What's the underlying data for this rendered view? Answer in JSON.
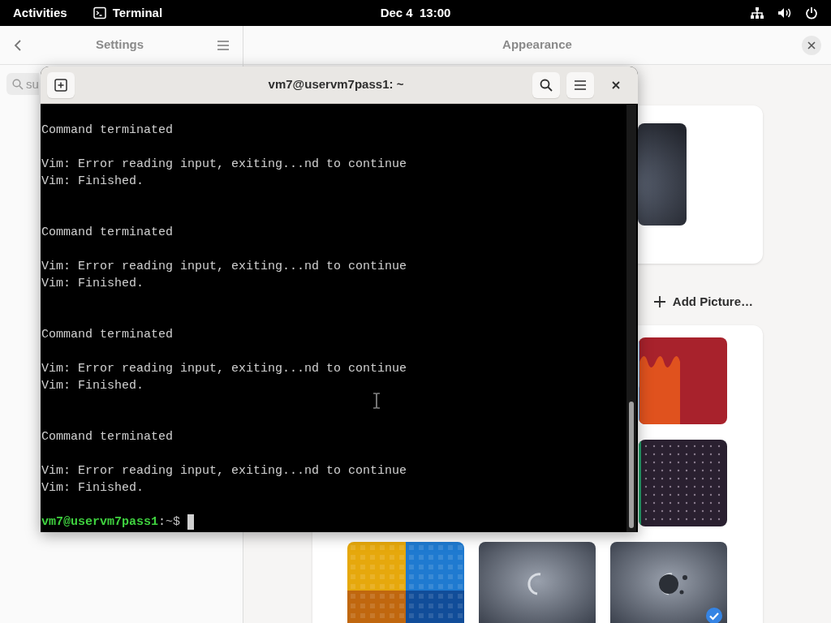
{
  "top_bar": {
    "activities": "Activities",
    "app": "Terminal",
    "clock": "Dec 4  13:00"
  },
  "settings": {
    "sidebar_title": "Settings",
    "search": {
      "value": "su"
    },
    "panel_title": "Appearance",
    "add_picture": "Add Picture…",
    "wallpaper_rows": [
      [
        {
          "selected": false
        }
      ],
      [
        {
          "selected": false
        }
      ],
      [
        {
          "selected": false
        },
        {
          "selected": false
        },
        {
          "selected": true
        }
      ]
    ]
  },
  "terminal": {
    "title": "vm7@uservm7pass1: ~",
    "lines": [
      {
        "kind": "status",
        "text": "Command terminated"
      },
      {
        "kind": "output",
        "text": "Vim: Error reading input, exiting...nd to continue"
      },
      {
        "kind": "finished",
        "text": "Vim: Finished."
      },
      {
        "kind": "status",
        "text": "Command terminated"
      },
      {
        "kind": "output",
        "text": "Vim: Error reading input, exiting...nd to continue"
      },
      {
        "kind": "finished",
        "text": "Vim: Finished."
      },
      {
        "kind": "status",
        "text": "Command terminated"
      },
      {
        "kind": "output",
        "text": "Vim: Error reading input, exiting...nd to continue"
      },
      {
        "kind": "finished",
        "text": "Vim: Finished."
      },
      {
        "kind": "status",
        "text": "Command terminated"
      },
      {
        "kind": "output",
        "text": "Vim: Error reading input, exiting...nd to continue"
      },
      {
        "kind": "finished",
        "text": "Vim: Finished."
      }
    ],
    "prompt": {
      "user_host": "vm7@uservm7pass1",
      "separator": ":",
      "path": "~",
      "symbol": "$"
    }
  }
}
